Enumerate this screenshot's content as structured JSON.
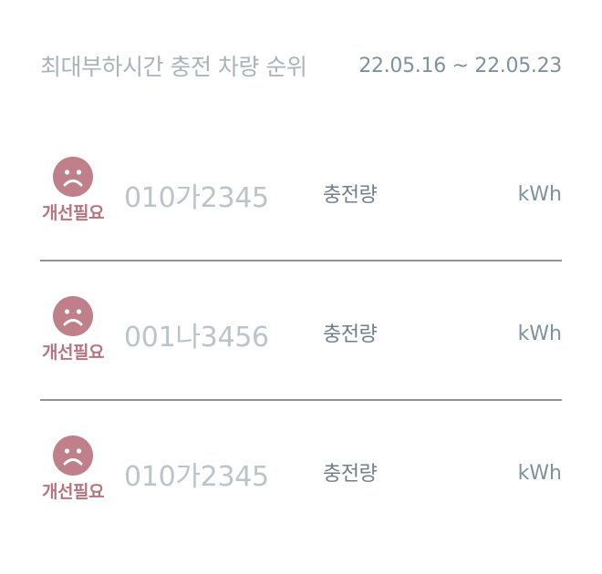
{
  "header": {
    "title": "최대부하시간  충전 차량 순위",
    "date_range": "22.05.16 ~ 22.05.23"
  },
  "rows": [
    {
      "status_icon": "sad-face-icon",
      "status_label": "개선필요",
      "plate": "010가2345",
      "metric_label": "충전량",
      "unit": "kWh"
    },
    {
      "status_icon": "sad-face-icon",
      "status_label": "개선필요",
      "plate": "001나3456",
      "metric_label": "충전량",
      "unit": "kWh"
    },
    {
      "status_icon": "sad-face-icon",
      "status_label": "개선필요",
      "plate": "010가2345",
      "metric_label": "충전량",
      "unit": "kWh"
    }
  ],
  "colors": {
    "status_bad": "#bf8089",
    "divider": "#8f9396",
    "title_text": "#a9b4b9"
  }
}
